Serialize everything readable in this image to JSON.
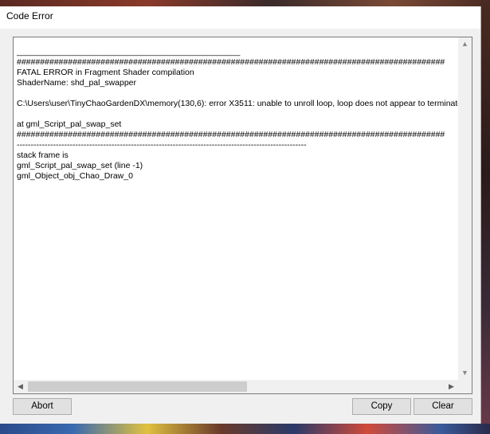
{
  "window": {
    "title": "Code Error"
  },
  "error_log": {
    "text": "________________________________________________\n############################################################################################\nFATAL ERROR in Fragment Shader compilation\nShaderName: shd_pal_swapper\n\nC:\\Users\\user\\TinyChaoGardenDX\\memory(130,6): error X3511: unable to unroll loop, loop does not appear to terminate in a timely manner\n\nat gml_Script_pal_swap_set\n############################################################################################\n--------------------------------------------------------------------------------------------------------\nstack frame is\ngml_Script_pal_swap_set (line -1)\ngml_Object_obj_Chao_Draw_0"
  },
  "scrollbars": {
    "up_arrow": "▲",
    "down_arrow": "▼",
    "left_arrow": "◀",
    "right_arrow": "▶"
  },
  "buttons": {
    "abort": "Abort",
    "copy": "Copy",
    "clear": "Clear"
  }
}
